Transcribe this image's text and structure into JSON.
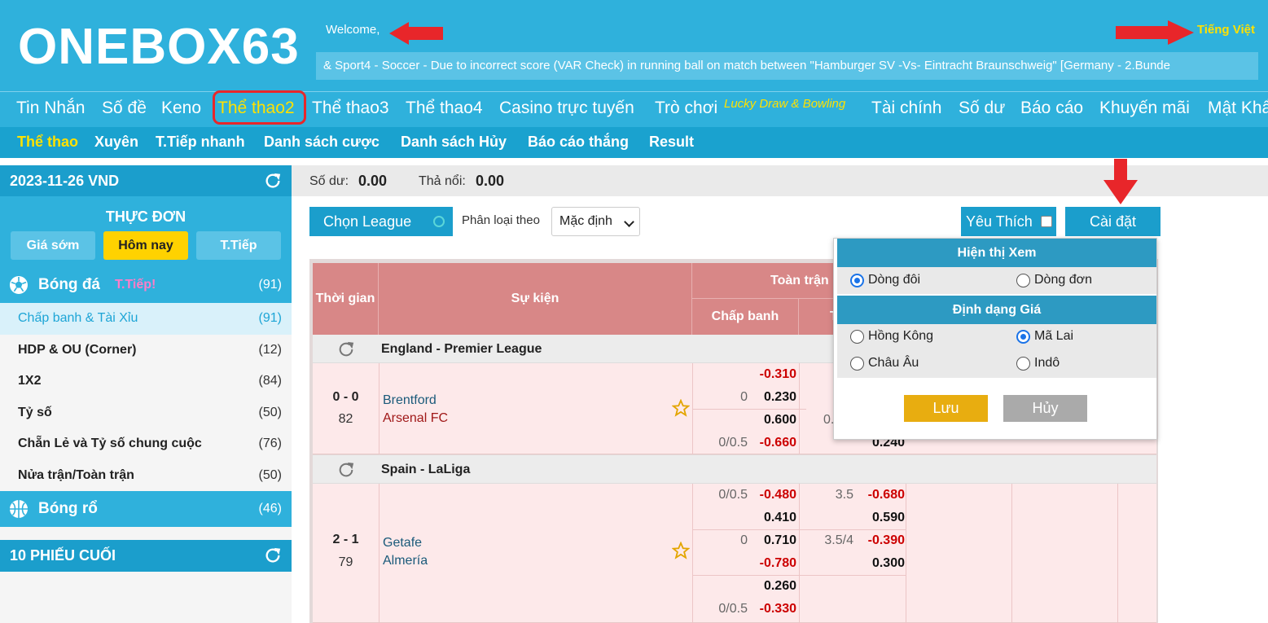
{
  "header": {
    "logo": "ONEBOX63",
    "welcome": "Welcome,",
    "language": "Tiếng Việt",
    "ticker": "& Sport4 - Soccer - Due to incorrect score (VAR Check) in running ball on match between \"Hamburger SV -Vs- Eintracht Braunschweig\" [Germany - 2.Bunde"
  },
  "main_nav": [
    "Tin Nhắn",
    "Số đề",
    "Keno",
    "Thể thao2",
    "Thể thao3",
    "Thể thao4",
    "Casino trực tuyến",
    "Trò chơi",
    "Tài chính",
    "Số dư",
    "Báo cáo",
    "Khuyến mãi",
    "Mật Khẩu"
  ],
  "main_nav_promo": "Lucky Draw & Bowling",
  "sub_nav": [
    "Thể thao",
    "Xuyên",
    "T.Tiếp nhanh",
    "Danh sách cược",
    "Danh sách Hủy",
    "Báo cáo thắng",
    "Result"
  ],
  "sidebar": {
    "date_header": "2023-11-26 VND",
    "menu_title": "THỰC ĐƠN",
    "menu_buttons": [
      "Giá sớm",
      "Hôm nay",
      "T.Tiếp"
    ],
    "football": {
      "label": "Bóng đá",
      "live": "T.Tiếp!",
      "count": "(91)"
    },
    "items": [
      {
        "label": "Chấp banh & Tài Xỉu",
        "count": "(91)"
      },
      {
        "label": "HDP & OU (Corner)",
        "count": "(12)"
      },
      {
        "label": "1X2",
        "count": "(84)"
      },
      {
        "label": "Tỷ số",
        "count": "(50)"
      },
      {
        "label": "Chẵn Lẻ và Tỷ số chung cuộc",
        "count": "(76)"
      },
      {
        "label": "Nửa trận/Toàn trận",
        "count": "(50)"
      }
    ],
    "basketball": {
      "label": "Bóng rổ",
      "count": "(46)"
    },
    "last_tickets": "10 PHIẾU CUỐI"
  },
  "balance": {
    "balance_label": "Số dư:",
    "balance_value": "0.00",
    "float_label": "Thả nổi:",
    "float_value": "0.00"
  },
  "toolbar": {
    "choose_league": "Chọn League",
    "sort_label": "Phân loại theo",
    "sort_value": "Mặc định",
    "favorites": "Yêu Thích",
    "settings": "Cài đặt"
  },
  "table": {
    "col_time": "Thời gian",
    "col_event": "Sự kiện",
    "col_fulltime": "Toàn trận",
    "col_handicap": "Chấp banh",
    "col_ou_partial": "T",
    "leagues": [
      {
        "name": "England - Premier League",
        "match": {
          "score": "0 - 0",
          "minute": "82",
          "home": "Brentford",
          "away": "Arsenal FC",
          "hdp_rows": [
            {
              "line": "",
              "odd1": "-0.310",
              "odd2": "0.230",
              "line2": "0"
            },
            {
              "line": "0/0.5",
              "odd1": "0.600",
              "odd2": "-0.660"
            }
          ],
          "ou_partial": [
            "0.",
            "0.240"
          ]
        }
      },
      {
        "name": "Spain - LaLiga",
        "match": {
          "score": "2 - 1",
          "minute": "79",
          "home": "Getafe",
          "away": "Almería",
          "hdp_rows": [
            {
              "line": "0/0.5",
              "odd1": "-0.480",
              "odd2": "0.410"
            },
            {
              "line": "0",
              "odd1": "0.710",
              "odd2": "-0.780"
            },
            {
              "line": "0/0.5",
              "odd1": "0.260",
              "odd2": "-0.330"
            }
          ],
          "ou_rows": [
            {
              "line": "3.5",
              "odd1": "-0.680",
              "odd2": "0.590"
            },
            {
              "line": "3.5/4",
              "odd1": "-0.390",
              "odd2": "0.300"
            }
          ]
        }
      }
    ]
  },
  "popup": {
    "view_title": "Hiện thị Xem",
    "view_options": [
      "Dòng đôi",
      "Dòng đơn"
    ],
    "price_title": "Định dạng Giá",
    "price_options": [
      "Hồng Kông",
      "Mã Lai",
      "Châu Âu",
      "Indô"
    ],
    "save": "Lưu",
    "cancel": "Hủy"
  },
  "colors": {
    "brand": "#2fb1dc",
    "highlight": "#ffd200",
    "annotation_red": "#e8262a"
  }
}
